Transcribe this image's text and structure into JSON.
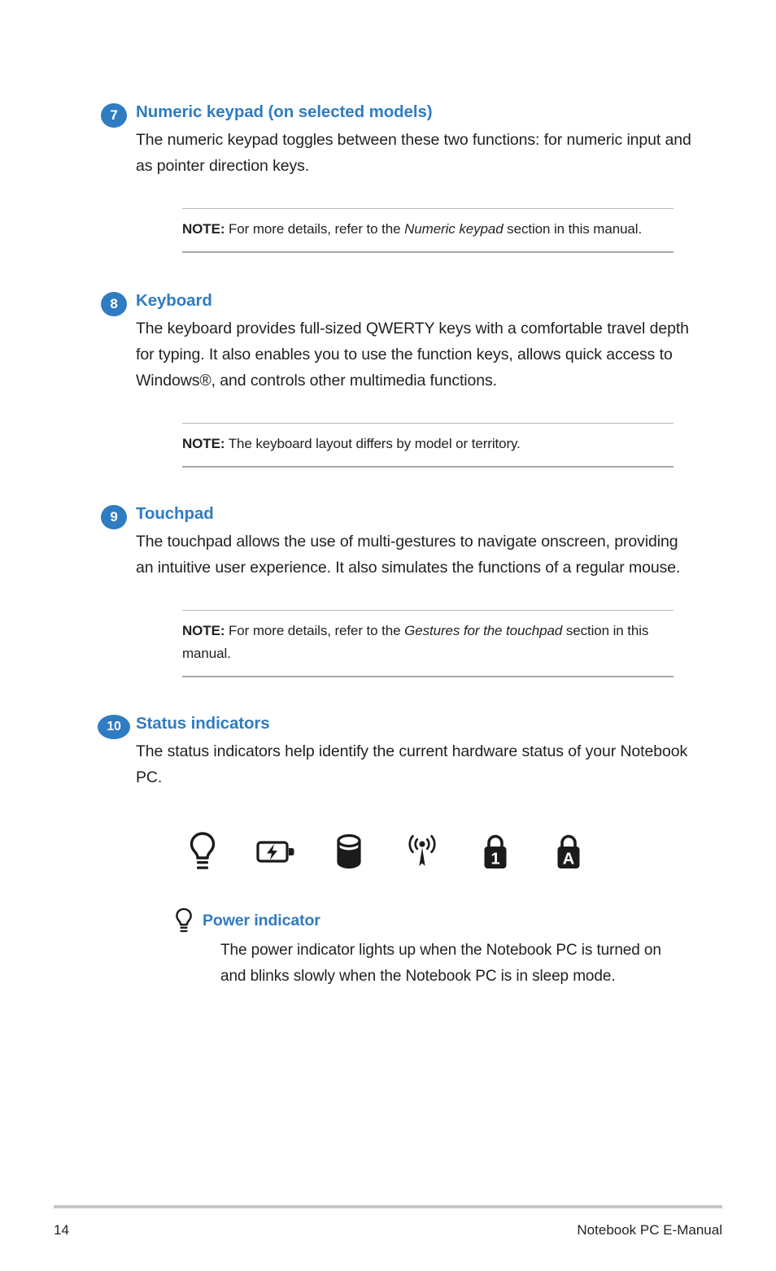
{
  "document": {
    "title": "Notebook PC E-Manual",
    "page_number": "14"
  },
  "sections": [
    {
      "number": "7",
      "heading": "Numeric keypad (on selected models)",
      "body": "The numeric keypad toggles between these two functions: for numeric input and as pointer direction keys.",
      "note": {
        "label": "NOTE:",
        "text_before": " For more details, refer to the ",
        "italic": "Numeric keypad",
        "text_after": " section in this manual."
      }
    },
    {
      "number": "8",
      "heading": "Keyboard",
      "body": "The keyboard provides full-sized QWERTY keys with a comfortable travel depth for typing. It also enables you to use the function keys, allows quick access to Windows®, and controls other multimedia functions.",
      "note": {
        "label": "NOTE:",
        "text_before": " The keyboard layout differs by model or territory.",
        "italic": "",
        "text_after": ""
      }
    },
    {
      "number": "9",
      "heading": "Touchpad",
      "body": "The touchpad allows the use of multi-gestures to navigate onscreen, providing an intuitive user experience. It also simulates the functions of a regular mouse.",
      "note": {
        "label": "NOTE:",
        "text_before": " For more details, refer to the ",
        "italic": "Gestures for the touchpad",
        "text_after": " section in this manual."
      }
    },
    {
      "number": "10",
      "heading": "Status indicators",
      "body": "The status indicators help identify the current hardware status of your Notebook PC.",
      "note": null
    }
  ],
  "status_indicators": {
    "icons": [
      "power-indicator-icon",
      "battery-charge-indicator-icon",
      "drive-activity-indicator-icon",
      "wireless-bluetooth-indicator-icon",
      "number-lock-indicator-icon",
      "capital-lock-indicator-icon"
    ],
    "lock_labels": {
      "number_lock": "1",
      "capital_lock": "A"
    }
  },
  "power_indicator": {
    "icon": "power-indicator-icon",
    "title": "Power indicator",
    "body": "The power indicator lights up when the Notebook PC is turned on and blinks slowly when the Notebook PC is in sleep mode."
  },
  "colors": {
    "accent_blue": "#2f7cc2",
    "body_text": "#231f20",
    "rule_gray": "#b7b7b7",
    "footer_rule": "#c6c6c6"
  }
}
